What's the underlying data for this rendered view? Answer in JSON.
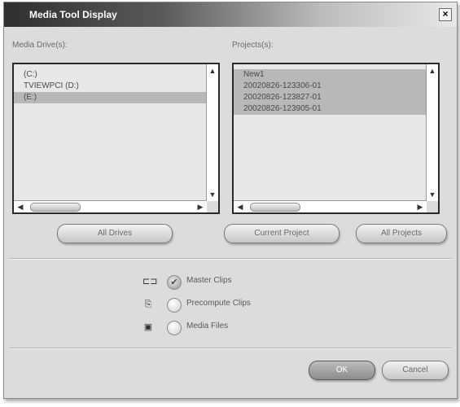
{
  "window": {
    "title": "Media Tool Display",
    "close_label": "×"
  },
  "media_drives": {
    "label": "Media Drive(s):",
    "items": [
      {
        "label": "(C:)",
        "selected": false
      },
      {
        "label": "TVIEWPCI (D:)",
        "selected": false
      },
      {
        "label": "(E:)",
        "selected": true
      }
    ]
  },
  "projects": {
    "label": "Projects(s):",
    "items": [
      {
        "label": "New1",
        "selected": true
      },
      {
        "label": "20020826-123306-01",
        "selected": true
      },
      {
        "label": "20020826-123827-01",
        "selected": true
      },
      {
        "label": "20020826-123905-01",
        "selected": true
      }
    ]
  },
  "scroll_glyphs": {
    "up": "▲",
    "down": "▼",
    "left": "◀",
    "right": "▶"
  },
  "buttons": {
    "all_drives": "All Drives",
    "current_project": "Current Project",
    "all_projects": "All Projects",
    "ok": "OK",
    "cancel": "Cancel"
  },
  "options": [
    {
      "icon": "master-clip-icon",
      "glyph": "⊏⊐",
      "label": "Master Clips",
      "checked": true,
      "check_glyph": "✔"
    },
    {
      "icon": "precompute-clip-icon",
      "glyph": "⎘",
      "label": "Precompute Clips",
      "checked": false,
      "check_glyph": ""
    },
    {
      "icon": "media-file-icon",
      "glyph": "▣",
      "label": "Media Files",
      "checked": false,
      "check_glyph": ""
    }
  ],
  "colors": {
    "selection": "#b8b8b8",
    "titlebar_dark": "#2f2f2f",
    "window_bg": "#dcdcdc"
  }
}
